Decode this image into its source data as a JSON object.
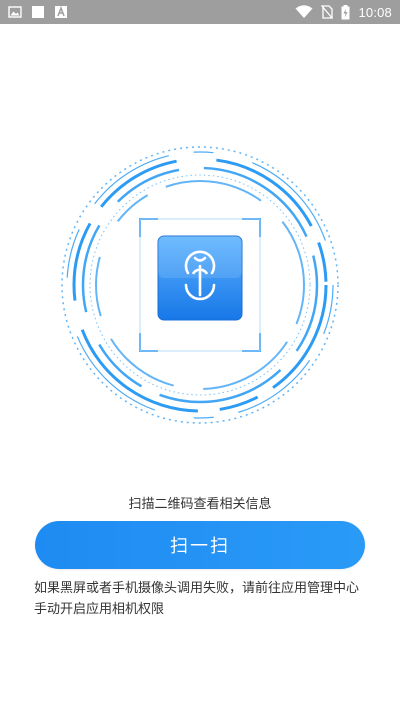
{
  "status_bar": {
    "time": "10:08",
    "icons": [
      "image-icon",
      "square-icon",
      "font-icon",
      "wifi-icon",
      "no-sim-icon",
      "battery-charging-icon"
    ]
  },
  "scanner": {
    "icon": "metro-logo-icon",
    "colors": {
      "ring": "#2196f3",
      "tile_top": "#5cb3ff",
      "tile_bottom": "#1877e8"
    }
  },
  "hint_text": "扫描二维码查看相关信息",
  "scan_button_label": "扫一扫",
  "permission_note": "如果黑屏或者手机摄像头调用失败，请前往应用管理中心手动开启应用相机权限"
}
